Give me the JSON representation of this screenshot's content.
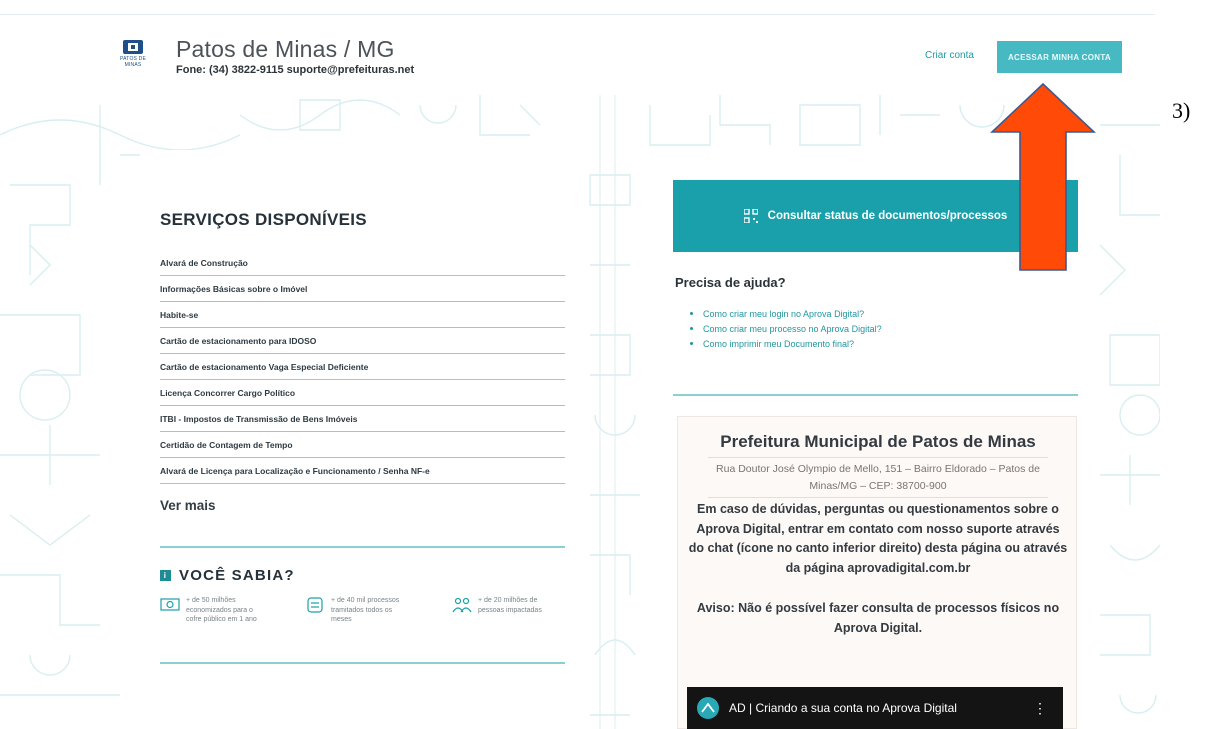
{
  "header": {
    "logo_text": "PATOS DE MINAS",
    "city": "Patos de Minas / MG",
    "contact": "Fone: (34) 3822-9115 suporte@prefeituras.net",
    "criar_conta": "Criar conta",
    "acessar": "ACESSAR MINHA CONTA"
  },
  "services": {
    "title": "SERVIÇOS DISPONÍVEIS",
    "items": [
      "Alvará de Construção",
      "Informações Básicas sobre o Imóvel",
      "Habite-se",
      "Cartão de estacionamento para IDOSO",
      "Cartão de estacionamento Vaga Especial Deficiente",
      "Licença Concorrer Cargo Político",
      "ITBI - Impostos de Transmissão de Bens Imóveis",
      "Certidão de Contagem de Tempo",
      "Alvará de Licença para Localização e Funcionamento / Senha NF-e"
    ],
    "ver_mais": "Ver mais"
  },
  "sabia": {
    "title": "VOCÊ SABIA?",
    "stats": [
      {
        "text": "+ de 50 milhões economizados para o cofre público em 1 ano",
        "icon": "money-icon"
      },
      {
        "text": "+ de 40 mil processos tramitados todos os meses",
        "icon": "document-stack-icon"
      },
      {
        "text": "+ de 20 milhões de pessoas impactadas",
        "icon": "people-icon"
      }
    ]
  },
  "consultar": {
    "label": "Consultar status de documentos/processos",
    "icon": "qr-icon"
  },
  "ajuda": {
    "title": "Precisa de ajuda?",
    "links": [
      "Como criar meu login no Aprova Digital?",
      "Como criar meu processo no Aprova Digital?",
      "Como imprimir meu Documento final?"
    ]
  },
  "prefeitura": {
    "title": "Prefeitura Municipal de Patos de Minas",
    "address": "Rua Doutor José Olympio de Mello, 151 – Bairro Eldorado – Patos de Minas/MG – CEP: 38700-900",
    "help": "Em caso de dúvidas, perguntas ou questionamentos sobre o Aprova Digital, entrar em contato com nosso suporte através do chat (ícone no canto inferior direito) desta página ou através da página aprovadigital.com.br",
    "aviso": "Aviso: Não é possível fazer consulta de processos físicos no Aprova Digital."
  },
  "video": {
    "title": "AD | Criando a sua conta no Aprova Digital",
    "menu": "⋮"
  },
  "annotation": {
    "label": "3)",
    "arrow_color": "#ff4a08"
  },
  "colors": {
    "accent": "#1aa0aa",
    "button": "#46b9c2",
    "line": "#8ccfd3"
  }
}
